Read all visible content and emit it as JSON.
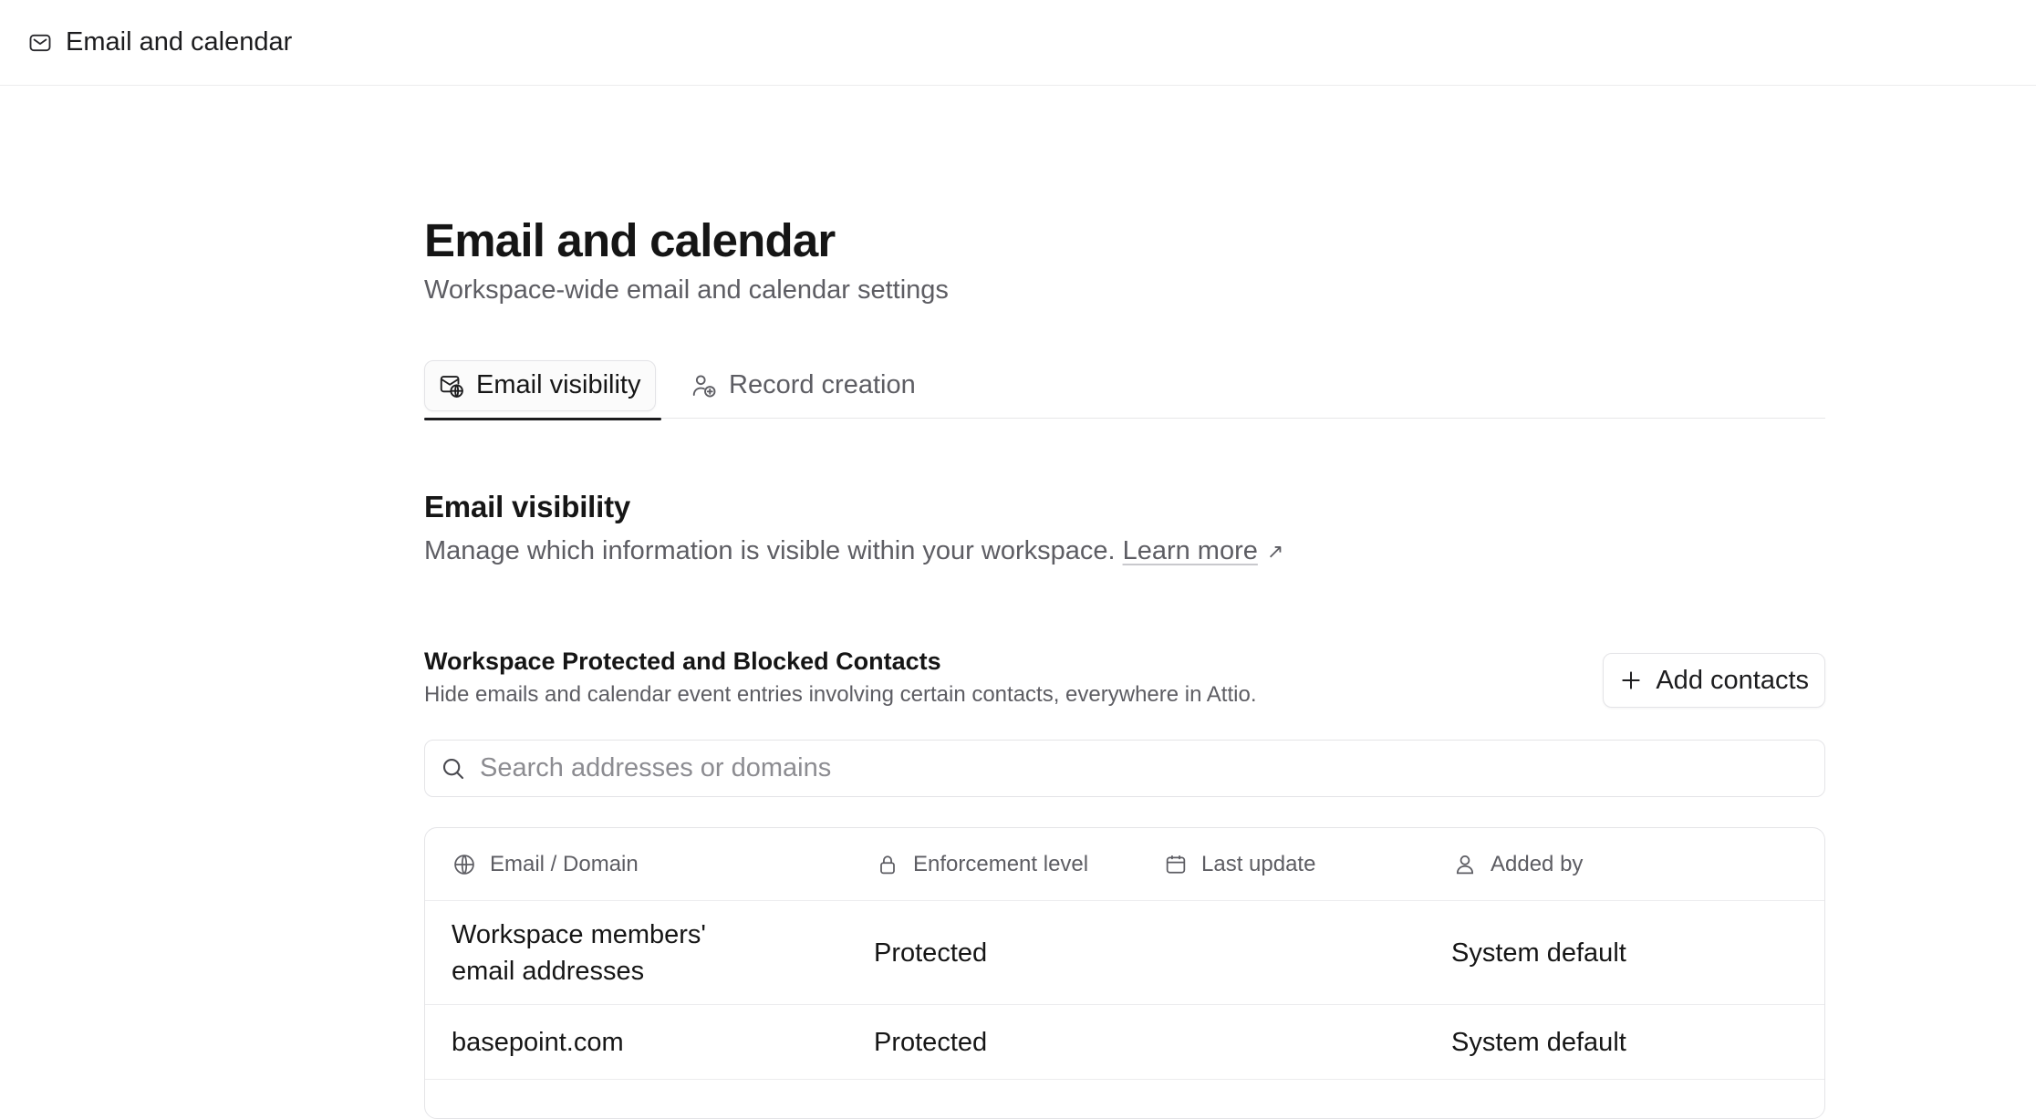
{
  "topbar": {
    "title": "Email and calendar",
    "icon": "mail-icon"
  },
  "page": {
    "title": "Email and calendar",
    "subtitle": "Workspace-wide email and calendar settings"
  },
  "tabs": [
    {
      "label": "Email visibility",
      "icon": "mail-globe-icon",
      "active": true
    },
    {
      "label": "Record creation",
      "icon": "user-add-icon",
      "active": false
    }
  ],
  "section": {
    "title": "Email visibility",
    "description": "Manage which information is visible within your workspace.",
    "learn_more": "Learn more",
    "learn_more_arrow": "↗"
  },
  "contacts_block": {
    "title": "Workspace Protected and Blocked Contacts",
    "description": "Hide emails and calendar event entries involving certain contacts, everywhere in Attio.",
    "add_button": "Add contacts"
  },
  "search": {
    "placeholder": "Search addresses or domains",
    "value": ""
  },
  "table": {
    "columns": [
      {
        "label": "Email / Domain",
        "icon": "globe-icon"
      },
      {
        "label": "Enforcement level",
        "icon": "lock-icon"
      },
      {
        "label": "Last update",
        "icon": "calendar-icon"
      },
      {
        "label": "Added by",
        "icon": "user-icon"
      }
    ],
    "rows": [
      {
        "domain": "Workspace members' email addresses",
        "enforcement": "Protected",
        "last_update": "",
        "added_by": "System default"
      },
      {
        "domain": "basepoint.com",
        "enforcement": "Protected",
        "last_update": "",
        "added_by": "System default"
      }
    ]
  },
  "colors": {
    "text": "#1a1a1a",
    "muted": "#5d5d63",
    "border": "#e4e4e7",
    "tab_indicator": "#1c1c1e"
  }
}
